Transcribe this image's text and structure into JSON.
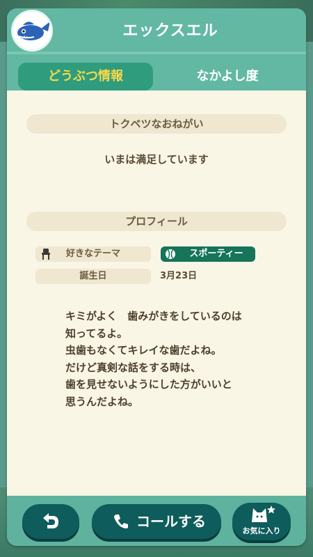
{
  "header": {
    "villager_name": "エックスエル"
  },
  "tabs": [
    {
      "label": "どうぶつ情報",
      "active": true
    },
    {
      "label": "なかよし度",
      "active": false
    }
  ],
  "special_request": {
    "heading": "トクベツなおねがい",
    "status": "いまは満足しています"
  },
  "profile": {
    "heading": "プロフィール",
    "favorite_theme_label": "好きなテーマ",
    "favorite_theme_value": "スポーティー",
    "birthday_label": "誕生日",
    "birthday_value": "3月23日"
  },
  "quote": "キミがよく　歯みがきをしているのは\n知ってるよ。\n虫歯もなくてキレイな歯だよね。\nだけど真剣な話をする時は、\n歯を見せないようにした方がいいと\n思うんだよね。",
  "footer": {
    "call_label": "コールする",
    "favorite_label": "お気に入り"
  },
  "colors": {
    "panel": "#5fb39e",
    "active_tab": "#2f9c7e",
    "active_tab_text": "#f6d94a",
    "content_bg": "#f9f6e6",
    "section_bg": "#efe7cf",
    "badge": "#15745a",
    "button": "#0f5c5c"
  },
  "icons": {
    "avatar": "villager-avatar-icon",
    "theme": "chair-icon",
    "sporty": "ball-icon",
    "back": "back-arrow-icon",
    "call": "phone-icon",
    "favorite": "cat-star-icon"
  }
}
